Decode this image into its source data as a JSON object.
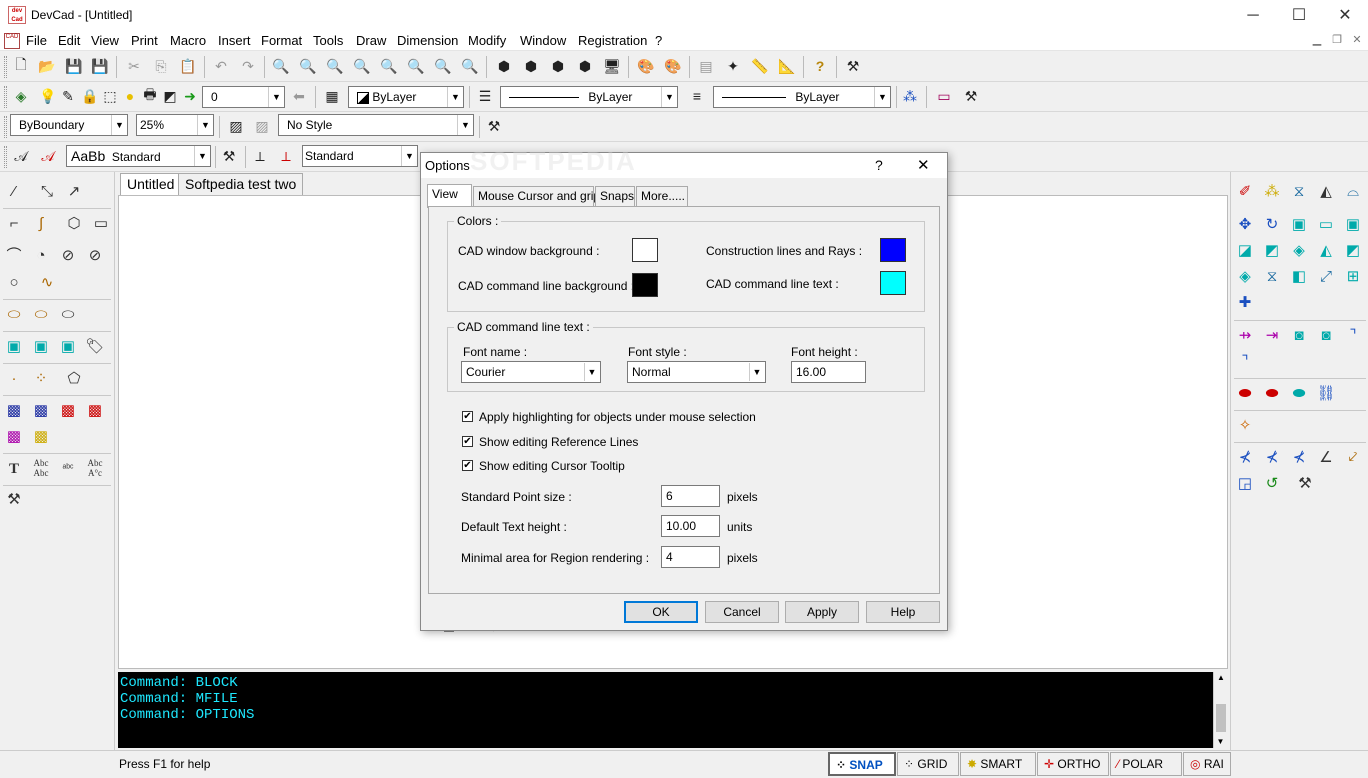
{
  "window": {
    "title": "DevCad - [Untitled]",
    "logo": "dev Cad",
    "minimize": "─",
    "maximize": "☐",
    "close": "✕"
  },
  "menu": [
    "File",
    "Edit",
    "View",
    "Print",
    "Macro",
    "Insert",
    "Format",
    "Tools",
    "Draw",
    "Dimension",
    "Modify",
    "Window",
    "Registration",
    "?"
  ],
  "toolbar2": {
    "layer_value": "0",
    "color_value": "ByLayer",
    "linetype_value": "ByLayer",
    "lineweight_value": "ByLayer"
  },
  "toolbar3": {
    "hatch_value": "ByBoundary",
    "scale_value": "25%",
    "style_value": "No Style"
  },
  "toolbar4": {
    "text_sample": "AaBb",
    "text_style": "Standard",
    "dim_style": "Standard"
  },
  "docs": {
    "tab1": "Untitled",
    "tab2": "Softpedia test two"
  },
  "command": {
    "lines": [
      "Command: BLOCK",
      "Command: MFILE",
      "Command: OPTIONS"
    ]
  },
  "status": {
    "help": "Press F1 for help",
    "snap": "SNAP",
    "grid": "GRID",
    "smart": "SMART",
    "ortho": "ORTHO",
    "polar": "POLAR",
    "rad": "RAI"
  },
  "watermark": "SOFTPEDIA",
  "dialog": {
    "title": "Options",
    "help": "?",
    "close": "✕",
    "tabs": [
      "View",
      "Mouse Cursor and grips",
      "Snaps",
      "More....."
    ],
    "colors": {
      "group": "Colors :",
      "cad_bg_label": "CAD window background :",
      "cad_bg": "#ffffff",
      "cmd_bg_label": "CAD command line background :",
      "cmd_bg": "#000000",
      "constr_label": "Construction lines and Rays :",
      "constr": "#0000ff",
      "cmd_text_label": "CAD command line text :",
      "cmd_text": "#00ffff"
    },
    "font": {
      "group": "CAD command line text :",
      "name_label": "Font name :",
      "name": "Courier",
      "style_label": "Font style :",
      "style": "Normal",
      "height_label": "Font height :",
      "height": "16.00"
    },
    "checks": [
      {
        "label": "Apply highlighting for objects under mouse selection",
        "checked": "✔"
      },
      {
        "label": "Show editing Reference Lines",
        "checked": "✔"
      },
      {
        "label": "Show editing Cursor Tooltip",
        "checked": "✔"
      }
    ],
    "fields": [
      {
        "label": "Standard Point size :",
        "value": "6",
        "unit": "pixels"
      },
      {
        "label": "Default Text height :",
        "value": "10.00",
        "unit": "units"
      },
      {
        "label": "Minimal area for Region rendering :",
        "value": "4",
        "unit": "pixels"
      }
    ],
    "buttons": {
      "ok": "OK",
      "cancel": "Cancel",
      "apply": "Apply",
      "help": "Help"
    }
  }
}
